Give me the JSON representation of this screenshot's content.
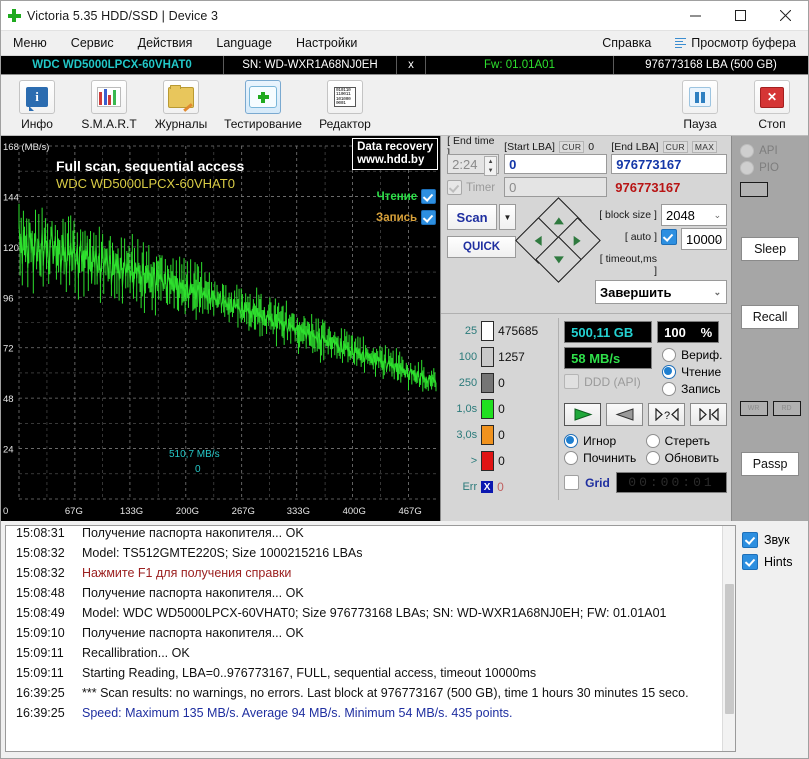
{
  "window": {
    "title": "Victoria 5.35 HDD/SSD | Device 3",
    "icon": "green-cross-icon",
    "minimize": "–",
    "maximize": "□",
    "close": "✕"
  },
  "menu": {
    "items": [
      "Меню",
      "Сервис",
      "Действия",
      "Language",
      "Настройки"
    ],
    "help": "Справка",
    "buffer_view": "Просмотр буфера"
  },
  "device_bar": {
    "model": "WDC WD5000LPCX-60VHAT0",
    "serial": "SN: WD-WXR1A68NJ0EH",
    "x": "x",
    "firmware": "Fw: 01.01A01",
    "capacity": "976773168 LBA (500 GB)"
  },
  "toolbar": {
    "buttons": [
      {
        "label": "Инфо",
        "icon": "info-icon"
      },
      {
        "label": "S.M.A.R.T",
        "icon": "smart-bars-icon"
      },
      {
        "label": "Журналы",
        "icon": "folder-pencil-icon"
      },
      {
        "label": "Тестирование",
        "icon": "test-cross-icon"
      },
      {
        "label": "Редактор",
        "icon": "binary-editor-icon"
      }
    ],
    "pause": {
      "label": "Пауза",
      "icon": "pause-icon"
    },
    "stop": {
      "label": "Стоп",
      "icon": "stop-x-icon"
    }
  },
  "graph": {
    "title": "Full scan, sequential access",
    "subtitle": "WDC WD5000LPCX-60VHAT0",
    "badge_line1": "Data recovery",
    "badge_line2": "www.hdd.by",
    "read_label": "Чтение",
    "write_label": "Запись",
    "speed_note": "510,7 MB/s",
    "speed_note_count": "0",
    "y_unit": "168 (MB/s)"
  },
  "chart_data": {
    "type": "line",
    "title": "Full scan, sequential access",
    "subtitle": "WDC WD5000LPCX-60VHAT0",
    "xlabel": "",
    "ylabel": "MB/s",
    "ylim": [
      0,
      168
    ],
    "xlim": [
      0,
      500
    ],
    "yticks": [
      168,
      144,
      120,
      96,
      72,
      48,
      24,
      0
    ],
    "ytick_labels": [
      "168 (MB/s)",
      "144",
      "120",
      "96",
      "72",
      "48",
      "24",
      "0"
    ],
    "xticks": [
      0,
      67,
      133,
      200,
      267,
      333,
      400,
      467
    ],
    "xtick_labels": [
      "0",
      "67G",
      "133G",
      "200G",
      "267G",
      "333G",
      "400G",
      "467G"
    ],
    "grid": true,
    "series": [
      {
        "name": "Read speed",
        "color": "#2ee02e",
        "max": 135,
        "average": 94,
        "min": 54,
        "points": 435,
        "values": [
          132,
          118,
          125,
          112,
          128,
          120,
          115,
          126,
          110,
          122,
          130,
          117,
          124,
          108,
          121,
          127,
          113,
          119,
          123,
          109,
          116,
          128,
          111,
          120,
          126,
          114,
          122,
          107,
          118,
          124,
          129,
          112,
          119,
          125,
          110,
          121,
          116,
          123,
          108,
          117,
          127,
          113,
          120,
          106,
          118,
          124,
          111,
          122,
          115,
          119,
          125,
          109,
          116,
          121,
          105,
          117,
          123,
          112,
          118,
          108,
          120,
          114,
          122,
          107,
          115,
          119,
          104,
          113,
          118,
          110,
          121,
          106,
          114,
          117,
          103,
          112,
          120,
          108,
          115,
          111,
          118,
          105,
          113,
          116,
          102,
          110,
          117,
          107,
          114,
          109,
          116,
          104,
          111,
          115,
          101,
          109,
          114,
          106,
          112,
          108,
          113,
          103,
          110,
          114,
          100,
          108,
          112,
          105,
          111,
          107,
          109,
          102,
          108,
          112,
          99,
          107,
          110,
          104,
          109,
          106,
          108,
          101,
          106,
          110,
          98,
          105,
          109,
          103,
          107,
          104,
          106,
          100,
          104,
          108,
          97,
          103,
          107,
          102,
          105,
          101,
          104,
          98,
          102,
          106,
          95,
          101,
          105,
          100,
          103,
          99,
          102,
          96,
          100,
          104,
          94,
          99,
          103,
          98,
          101,
          97,
          100,
          95,
          99,
          102,
          93,
          97,
          101,
          96,
          99,
          95,
          98,
          94,
          97,
          100,
          92,
          96,
          99,
          95,
          97,
          93,
          96,
          92,
          95,
          98,
          91,
          94,
          97,
          93,
          95,
          91,
          94,
          90,
          93,
          96,
          89,
          92,
          95,
          91,
          93,
          90,
          92,
          88,
          91,
          94,
          87,
          90,
          93,
          89,
          91,
          88,
          90,
          86,
          89,
          92,
          85,
          88,
          91,
          87,
          89,
          86,
          88,
          84,
          87,
          90,
          83,
          86,
          88,
          85,
          87,
          84,
          86,
          82,
          85,
          88,
          81,
          84,
          86,
          83,
          85,
          82,
          84,
          80,
          83,
          85,
          79,
          82,
          84,
          81,
          83,
          80,
          82,
          78,
          81,
          83,
          77,
          80,
          82,
          79,
          81,
          78,
          80,
          76,
          79,
          81,
          75,
          78,
          80,
          77,
          79,
          76,
          78,
          74,
          77,
          79,
          73,
          76,
          78,
          75,
          77,
          74,
          76,
          72,
          75,
          77,
          71,
          74,
          76,
          73,
          75,
          72,
          74,
          70,
          73,
          75,
          69,
          72,
          74,
          71,
          73,
          70,
          72,
          68,
          71,
          73,
          67,
          70,
          72,
          69,
          71,
          68,
          70,
          66,
          69,
          71,
          65,
          68,
          70,
          67,
          69,
          66,
          68,
          64,
          67,
          69,
          63,
          66,
          68,
          65,
          67,
          64,
          66,
          62,
          65,
          67,
          61,
          64,
          66,
          63,
          65,
          62,
          64,
          60,
          63,
          65,
          59,
          62,
          64,
          61,
          63,
          60,
          62,
          58,
          61,
          63,
          57,
          60,
          62,
          59,
          61,
          58,
          60,
          56,
          59,
          61,
          55,
          58,
          60,
          57,
          59,
          56,
          58,
          55,
          57,
          59,
          54,
          57,
          58,
          56,
          57,
          55
        ]
      }
    ]
  },
  "controls": {
    "end_time_label": "[ End time ]",
    "end_time_value": "2:24",
    "start_lba_label": "[Start LBA]",
    "start_lba_cur": "CUR",
    "start_lba_cur_value": "0",
    "start_lba_value": "0",
    "end_lba_label": "[End LBA]",
    "end_lba_cur": "CUR",
    "end_lba_max": "MAX",
    "end_lba_value": "976773167",
    "end_lba_value2": "976773167",
    "timer_label": "Timer",
    "timer_value": "0",
    "scan_button": "Scan",
    "quick_button": "QUICK",
    "block_size_label": "[ block size ]",
    "block_size_value": "2048",
    "auto_label": "[ auto ]",
    "timeout_label": "[ timeout,ms ]",
    "timeout_value": "10000",
    "finish_value": "Завершить"
  },
  "counters": [
    {
      "threshold": "25",
      "color": "#ffffff",
      "value": "475685"
    },
    {
      "threshold": "100",
      "color": "#c9c9c9",
      "value": "1257"
    },
    {
      "threshold": "250",
      "color": "#757575",
      "value": "0"
    },
    {
      "threshold": "1,0s",
      "color": "#1fe01f",
      "value": "0"
    },
    {
      "threshold": "3,0s",
      "color": "#f0921e",
      "value": "0"
    },
    {
      "threshold": ">",
      "color": "#e01414",
      "value": "0"
    },
    {
      "threshold": "Err",
      "color": "#0b18b0",
      "value": "0"
    }
  ],
  "status": {
    "capacity_lcd": "500,11 GB",
    "percent_value": "100",
    "percent_sign": "%",
    "speed_lcd": "58 MB/s",
    "ddd_label": "DDD (API)",
    "modes": [
      {
        "label": "Вериф.",
        "selected": false
      },
      {
        "label": "Чтение",
        "selected": true
      },
      {
        "label": "Запись",
        "selected": false
      }
    ],
    "action_buttons": [
      "play-forward-icon",
      "play-back-icon",
      "seek-question-icon",
      "seek-end-icon"
    ],
    "fix_modes": [
      {
        "label": "Игнор",
        "selected": true
      },
      {
        "label": "Стереть",
        "selected": false
      },
      {
        "label": "Починить",
        "selected": false
      },
      {
        "label": "Обновить",
        "selected": false
      }
    ],
    "grid_label": "Grid",
    "grid_timer": "00:00:01"
  },
  "sidepanel": {
    "api_label": "API",
    "pio_label": "PIO",
    "sleep": "Sleep",
    "recall": "Recall",
    "wr": "WR",
    "rd": "RD",
    "passp": "Passp"
  },
  "log": {
    "entries": [
      {
        "time": "15:08:31",
        "text": "Получение паспорта накопителя... OK",
        "style": "normal"
      },
      {
        "time": "15:08:32",
        "text": "Model: TS512GMTE220S; Size 1000215216 LBAs",
        "style": "normal"
      },
      {
        "time": "15:08:32",
        "text": "Нажмите F1 для получения справки",
        "style": "red"
      },
      {
        "time": "15:08:48",
        "text": "Получение паспорта накопителя... OK",
        "style": "normal"
      },
      {
        "time": "15:08:49",
        "text": "Model: WDC WD5000LPCX-60VHAT0; Size 976773168 LBAs; SN: WD-WXR1A68NJ0EH; FW: 01.01A01",
        "style": "normal"
      },
      {
        "time": "15:09:10",
        "text": "Получение паспорта накопителя... OK",
        "style": "normal"
      },
      {
        "time": "15:09:11",
        "text": "Recallibration... OK",
        "style": "normal"
      },
      {
        "time": "15:09:11",
        "text": "Starting Reading, LBA=0..976773167, FULL, sequential access, timeout 10000ms",
        "style": "normal"
      },
      {
        "time": "16:39:25",
        "text": "*** Scan results: no warnings, no errors. Last block at 976773167 (500 GB), time 1 hours 30 minutes 15 seco.",
        "style": "normal"
      },
      {
        "time": "16:39:25",
        "text": "Speed: Maximum 135 MB/s. Average 94 MB/s. Minimum 54 MB/s. 435 points.",
        "style": "blue"
      }
    ],
    "sound_label": "Звук",
    "hints_label": "Hints"
  }
}
